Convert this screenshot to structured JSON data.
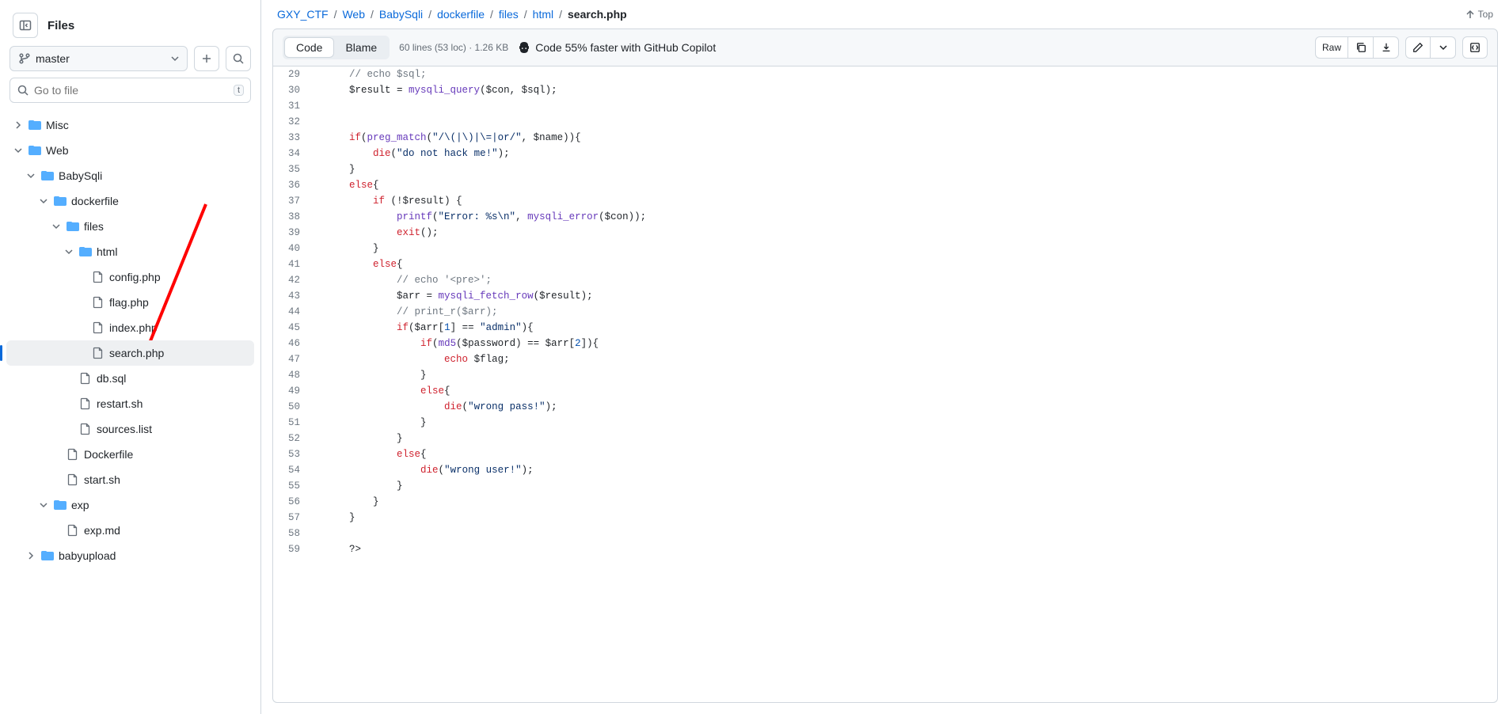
{
  "sidebar": {
    "title": "Files",
    "branch": "master",
    "search_placeholder": "Go to file",
    "search_kbd": "t",
    "tree": [
      {
        "type": "folder",
        "name": "Misc",
        "indent": 0,
        "open": false
      },
      {
        "type": "folder",
        "name": "Web",
        "indent": 0,
        "open": true
      },
      {
        "type": "folder",
        "name": "BabySqli",
        "indent": 1,
        "open": true
      },
      {
        "type": "folder",
        "name": "dockerfile",
        "indent": 2,
        "open": true
      },
      {
        "type": "folder",
        "name": "files",
        "indent": 3,
        "open": true
      },
      {
        "type": "folder",
        "name": "html",
        "indent": 4,
        "open": true
      },
      {
        "type": "file",
        "name": "config.php",
        "indent": 5
      },
      {
        "type": "file",
        "name": "flag.php",
        "indent": 5
      },
      {
        "type": "file",
        "name": "index.php",
        "indent": 5
      },
      {
        "type": "file",
        "name": "search.php",
        "indent": 5,
        "selected": true
      },
      {
        "type": "file",
        "name": "db.sql",
        "indent": 4
      },
      {
        "type": "file",
        "name": "restart.sh",
        "indent": 4
      },
      {
        "type": "file",
        "name": "sources.list",
        "indent": 4
      },
      {
        "type": "file",
        "name": "Dockerfile",
        "indent": 3
      },
      {
        "type": "file",
        "name": "start.sh",
        "indent": 3
      },
      {
        "type": "folder",
        "name": "exp",
        "indent": 2,
        "open": true
      },
      {
        "type": "file",
        "name": "exp.md",
        "indent": 3
      },
      {
        "type": "folder",
        "name": "babyupload",
        "indent": 1,
        "open": false
      }
    ]
  },
  "path": [
    "GXY_CTF",
    "Web",
    "BabySqli",
    "dockerfile",
    "files",
    "html",
    "search.php"
  ],
  "top_label": "Top",
  "toolbar": {
    "tabs": {
      "code": "Code",
      "blame": "Blame"
    },
    "meta": "60 lines (53 loc) · 1.26 KB",
    "copilot": "Code 55% faster with GitHub Copilot",
    "raw": "Raw"
  },
  "code_lines": [
    {
      "n": 29,
      "html": "    <span class='c-comment'>// echo $sql;</span>"
    },
    {
      "n": 30,
      "html": "    <span class='c-var'>$result</span> = <span class='c-func'>mysqli_query</span>(<span class='c-var'>$con</span>, <span class='c-var'>$sql</span>);"
    },
    {
      "n": 31,
      "html": ""
    },
    {
      "n": 32,
      "html": ""
    },
    {
      "n": 33,
      "html": "    <span class='c-kw'>if</span>(<span class='c-func'>preg_match</span>(<span class='c-str'>\"/\\(|\\)|\\=|or/\"</span>, <span class='c-var'>$name</span>)){"
    },
    {
      "n": 34,
      "html": "        <span class='c-kw'>die</span>(<span class='c-str'>\"do not hack me!\"</span>);"
    },
    {
      "n": 35,
      "html": "    }"
    },
    {
      "n": 36,
      "html": "    <span class='c-kw'>else</span>{"
    },
    {
      "n": 37,
      "html": "        <span class='c-kw'>if</span> (!<span class='c-var'>$result</span>) {"
    },
    {
      "n": 38,
      "html": "            <span class='c-func'>printf</span>(<span class='c-str'>\"Error: %s\\n\"</span>, <span class='c-func'>mysqli_error</span>(<span class='c-var'>$con</span>));"
    },
    {
      "n": 39,
      "html": "            <span class='c-kw'>exit</span>();"
    },
    {
      "n": 40,
      "html": "        }"
    },
    {
      "n": 41,
      "html": "        <span class='c-kw'>else</span>{"
    },
    {
      "n": 42,
      "html": "            <span class='c-comment'>// echo '&lt;pre&gt;';</span>"
    },
    {
      "n": 43,
      "html": "            <span class='c-var'>$arr</span> = <span class='c-func'>mysqli_fetch_row</span>(<span class='c-var'>$result</span>);"
    },
    {
      "n": 44,
      "html": "            <span class='c-comment'>// print_r($arr);</span>"
    },
    {
      "n": 45,
      "html": "            <span class='c-kw'>if</span>(<span class='c-var'>$arr</span>[<span class='c-num'>1</span>] == <span class='c-str'>\"admin\"</span>){"
    },
    {
      "n": 46,
      "html": "                <span class='c-kw'>if</span>(<span class='c-func'>md5</span>(<span class='c-var'>$password</span>) == <span class='c-var'>$arr</span>[<span class='c-num'>2</span>]){"
    },
    {
      "n": 47,
      "html": "                    <span class='c-kw'>echo</span> <span class='c-var'>$flag</span>;"
    },
    {
      "n": 48,
      "html": "                }"
    },
    {
      "n": 49,
      "html": "                <span class='c-kw'>else</span>{"
    },
    {
      "n": 50,
      "html": "                    <span class='c-kw'>die</span>(<span class='c-str'>\"wrong pass!\"</span>);"
    },
    {
      "n": 51,
      "html": "                }"
    },
    {
      "n": 52,
      "html": "            }"
    },
    {
      "n": 53,
      "html": "            <span class='c-kw'>else</span>{"
    },
    {
      "n": 54,
      "html": "                <span class='c-kw'>die</span>(<span class='c-str'>\"wrong user!\"</span>);"
    },
    {
      "n": 55,
      "html": "            }"
    },
    {
      "n": 56,
      "html": "        }"
    },
    {
      "n": 57,
      "html": "    }"
    },
    {
      "n": 58,
      "html": ""
    },
    {
      "n": 59,
      "html": "    ?&gt;"
    }
  ]
}
